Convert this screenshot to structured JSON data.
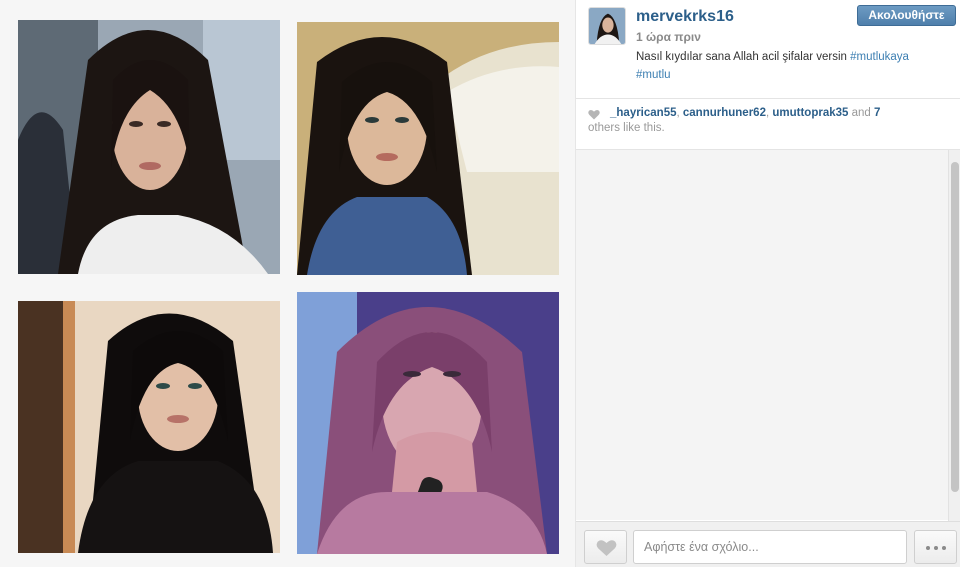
{
  "post": {
    "username": "mervekrks16",
    "time_ago": "1 ώρα πριν",
    "follow_label": "Ακολουθήστε",
    "caption_text": "Nasıl kıydılar sana Allah acil şifalar versin ",
    "caption_tag_1": "#mutlukaya",
    "caption_tag_2": "#mutlu"
  },
  "likes": {
    "user_1": "_hayrican55",
    "user_2": "cannurhuner62",
    "user_3": "umuttoprak35",
    "and_label": " and ",
    "count": "7",
    "suffix": "others like this."
  },
  "footer": {
    "comment_placeholder": "Αφήστε ένα σχόλιο..."
  },
  "icons": {
    "heart": "heart-icon",
    "more": "ellipsis-icon"
  },
  "colors": {
    "link": "#2c5f8a",
    "hashtag": "#3d7fb2",
    "follow_button": "#5a88b4"
  }
}
